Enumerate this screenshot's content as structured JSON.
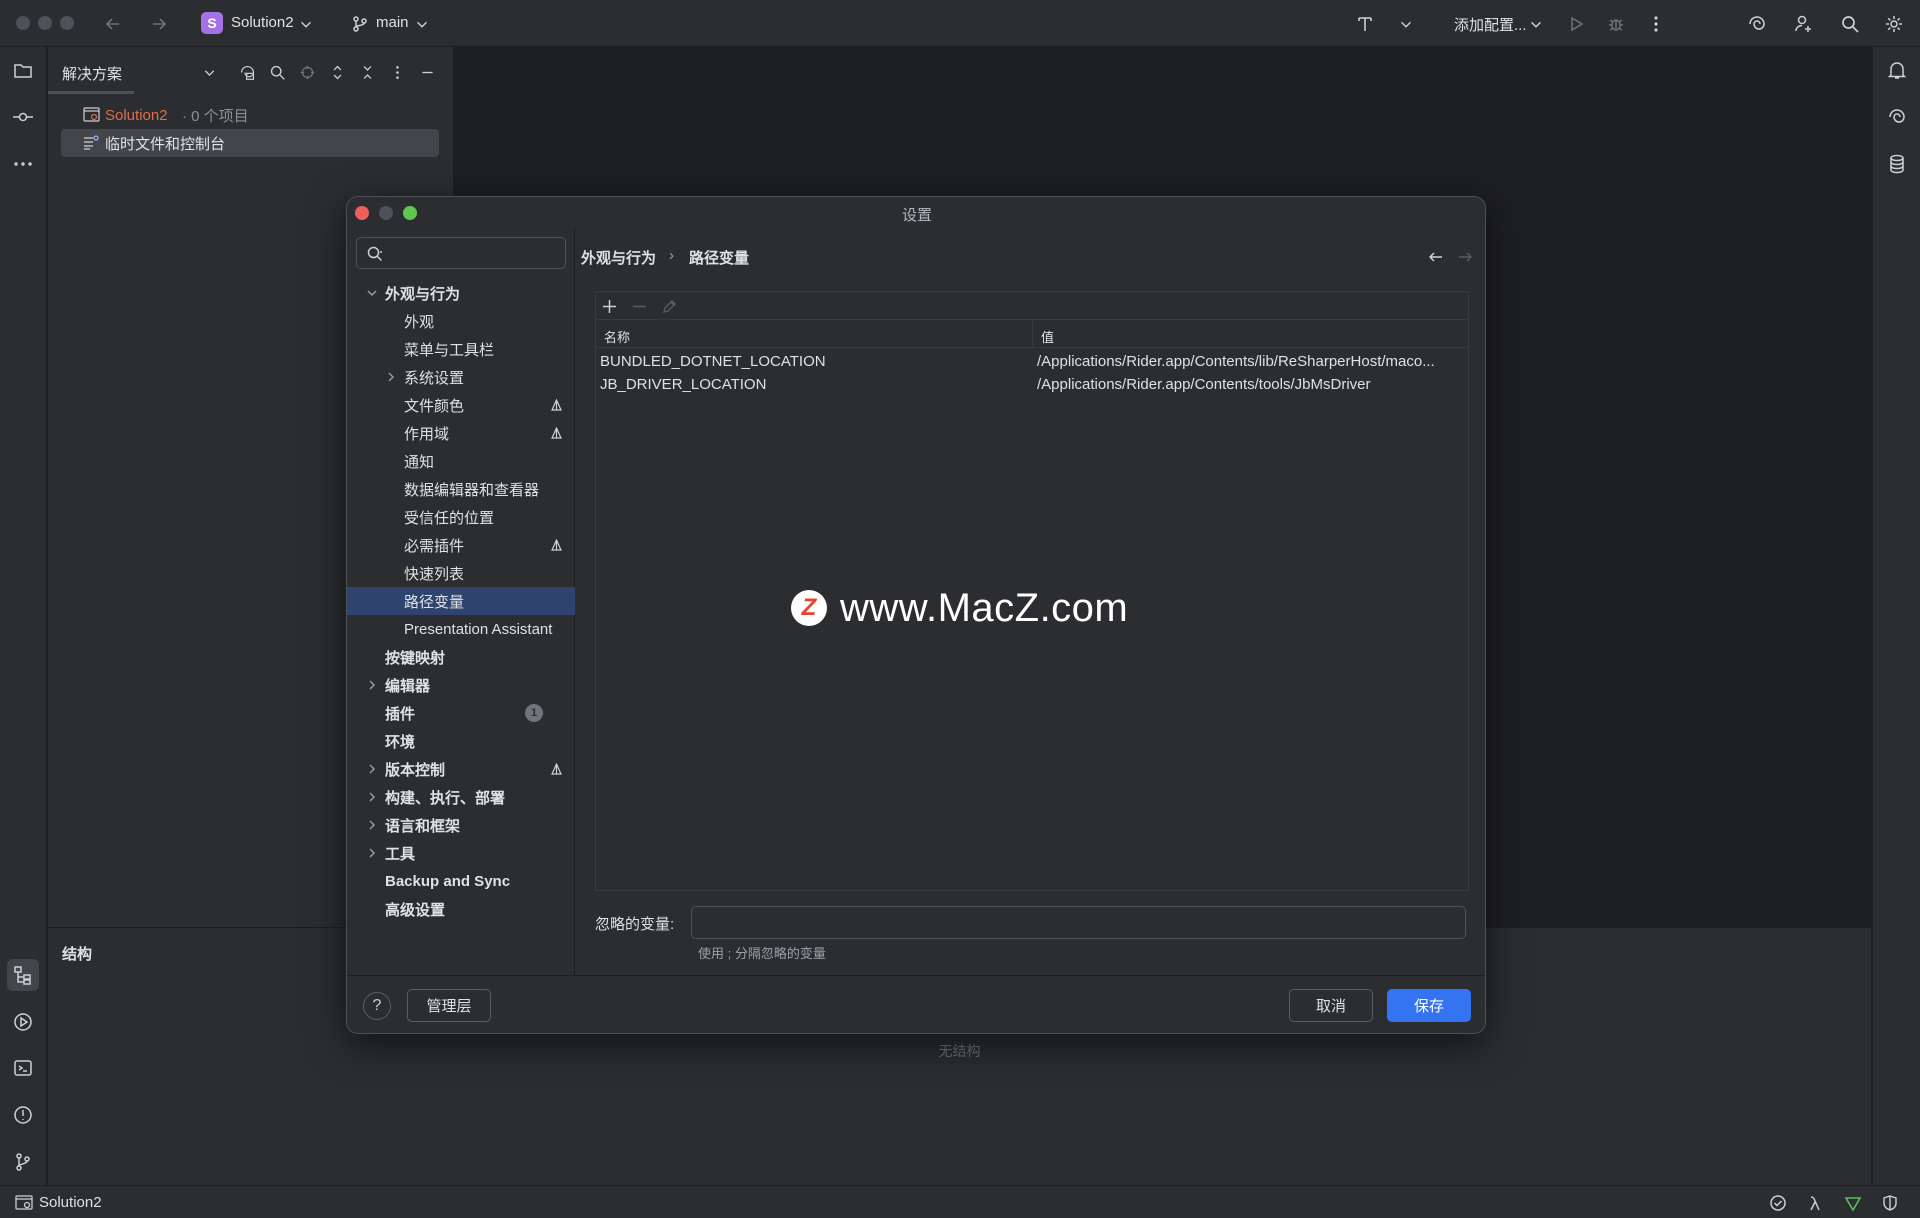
{
  "topbar": {
    "project_badge": "S",
    "project_name": "Solution2",
    "branch": "main",
    "add_config": "添加配置..."
  },
  "solution_panel": {
    "title": "解决方案",
    "tree": [
      {
        "name": "Solution2",
        "suffix": " · 0 个项目"
      },
      {
        "name": "临时文件和控制台"
      }
    ]
  },
  "structure_panel": {
    "title": "结构",
    "empty_text": "无结构"
  },
  "statusbar": {
    "project": "Solution2"
  },
  "dialog": {
    "title": "设置",
    "search": {
      "value": "",
      "placeholder": ""
    },
    "nav": [
      {
        "label": "外观与行为",
        "level": 0,
        "bold": true,
        "expanded": true
      },
      {
        "label": "外观",
        "level": 1
      },
      {
        "label": "菜单与工具栏",
        "level": 1
      },
      {
        "label": "系统设置",
        "level": 1,
        "collapsed": true
      },
      {
        "label": "文件颜色",
        "level": 1,
        "flag": true
      },
      {
        "label": "作用域",
        "level": 1,
        "flag": true
      },
      {
        "label": "通知",
        "level": 1
      },
      {
        "label": "数据编辑器和查看器",
        "level": 1
      },
      {
        "label": "受信任的位置",
        "level": 1
      },
      {
        "label": "必需插件",
        "level": 1,
        "flag": true
      },
      {
        "label": "快速列表",
        "level": 1
      },
      {
        "label": "路径变量",
        "level": 1,
        "selected": true
      },
      {
        "label": "Presentation Assistant",
        "level": 1
      },
      {
        "label": "按键映射",
        "level": 0,
        "bold": true
      },
      {
        "label": "编辑器",
        "level": 0,
        "bold": true,
        "collapsed": true
      },
      {
        "label": "插件",
        "level": 0,
        "bold": true,
        "badge": "1"
      },
      {
        "label": "环境",
        "level": 0,
        "bold": true
      },
      {
        "label": "版本控制",
        "level": 0,
        "bold": true,
        "collapsed": true,
        "flag": true
      },
      {
        "label": "构建、执行、部署",
        "level": 0,
        "bold": true,
        "collapsed": true
      },
      {
        "label": "语言和框架",
        "level": 0,
        "bold": true,
        "collapsed": true
      },
      {
        "label": "工具",
        "level": 0,
        "bold": true,
        "collapsed": true
      },
      {
        "label": "Backup and Sync",
        "level": 0,
        "bold": true
      },
      {
        "label": "高级设置",
        "level": 0,
        "bold": true
      }
    ],
    "breadcrumb": {
      "parent": "外观与行为",
      "separator": "›",
      "current": "路径变量"
    },
    "table": {
      "columns": [
        "名称",
        "值"
      ],
      "rows": [
        [
          "BUNDLED_DOTNET_LOCATION",
          "/Applications/Rider.app/Contents/lib/ReSharperHost/maco..."
        ],
        [
          "JB_DRIVER_LOCATION",
          "/Applications/Rider.app/Contents/tools/JbMsDriver"
        ]
      ]
    },
    "ignored": {
      "label": "忽略的变量:",
      "value": "",
      "hint": "使用 ; 分隔忽略的变量"
    },
    "buttons": {
      "help": "?",
      "manage": "管理层",
      "cancel": "取消",
      "save": "保存"
    }
  },
  "watermark": {
    "logo": "Z",
    "text": "www.MacZ.com"
  },
  "colors": {
    "accent": "#3574f0",
    "selection": "#2e436e",
    "project_badge": "#a571e6",
    "solution_name": "#e06c4f"
  }
}
